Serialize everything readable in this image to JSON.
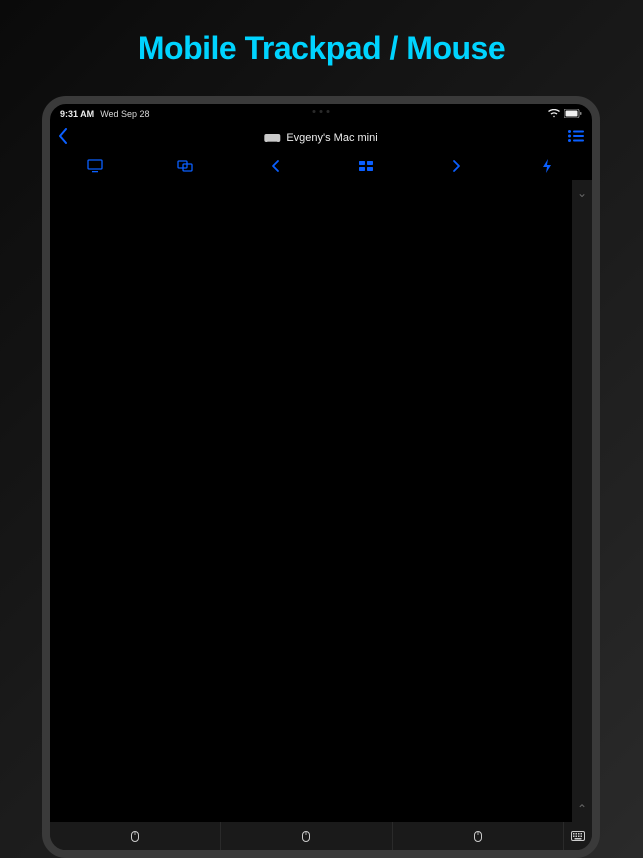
{
  "title": "Mobile Trackpad / Mouse",
  "statusBar": {
    "time": "9:31 AM",
    "date": "Wed Sep 28"
  },
  "navBar": {
    "deviceName": "Evgeny's Mac mini"
  },
  "icons": {
    "back": "chevron-left",
    "list": "list",
    "display": "display",
    "windows": "windows-overlap",
    "prev": "chevron-left",
    "spaces": "spaces-grid",
    "next": "chevron-right",
    "bolt": "bolt",
    "chevronDown": "⌄",
    "chevronUp": "⌃",
    "mouse": "mouse",
    "keyboard": "keyboard"
  }
}
